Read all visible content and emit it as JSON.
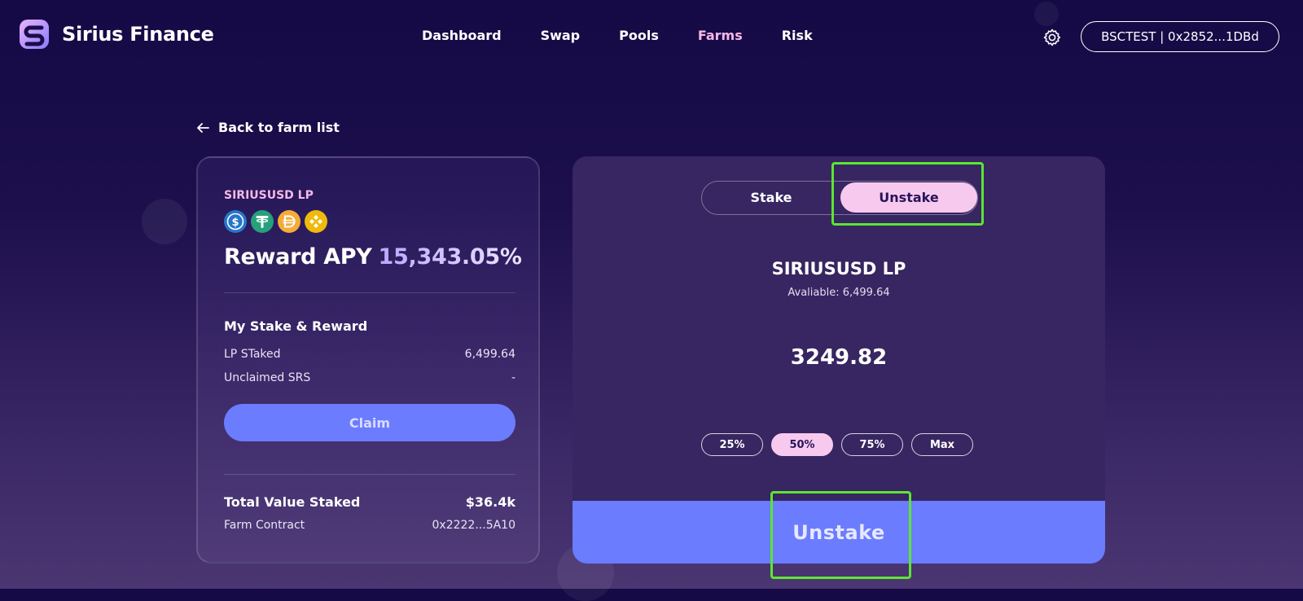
{
  "header": {
    "app_name": "Sirius Finance",
    "nav": [
      {
        "label": "Dashboard",
        "active": false
      },
      {
        "label": "Swap",
        "active": false
      },
      {
        "label": "Pools",
        "active": false
      },
      {
        "label": "Farms",
        "active": true
      },
      {
        "label": "Risk",
        "active": false
      }
    ],
    "wallet_label": "BSCTEST | 0x2852...1DBd",
    "settings_icon": "gear-icon"
  },
  "back_link": "Back to farm list",
  "farm_card": {
    "pool_name": "SIRIUSUSD LP",
    "tokens": [
      "usdc-icon",
      "usdt-icon",
      "dai-icon",
      "busd-icon"
    ],
    "reward_apy_label": "Reward APY",
    "reward_apy_value": "15,343.05%",
    "my_stake_title": "My Stake & Reward",
    "lp_staked_label": "LP STaked",
    "lp_staked_value": "6,499.64",
    "unclaimed_label": "Unclaimed SRS",
    "unclaimed_value": "-",
    "claim_label": "Claim",
    "total_value_label": "Total Value Staked",
    "total_value_value": "$36.4k",
    "contract_label": "Farm Contract",
    "contract_value": "0x2222...5A10"
  },
  "stake_panel": {
    "tabs": [
      {
        "label": "Stake",
        "active": false
      },
      {
        "label": "Unstake",
        "active": true
      }
    ],
    "lp_title": "SIRIUSUSD LP",
    "available_text": "Avaliable: 6,499.64",
    "amount": "3249.82",
    "percent_options": [
      {
        "label": "25%",
        "active": false
      },
      {
        "label": "50%",
        "active": true
      },
      {
        "label": "75%",
        "active": false
      },
      {
        "label": "Max",
        "active": false
      }
    ],
    "action_label": "Unstake"
  },
  "colors": {
    "accent_pink": "#f6b8e6",
    "button_blue": "#6b7cff",
    "highlight_green": "#5ce532"
  }
}
